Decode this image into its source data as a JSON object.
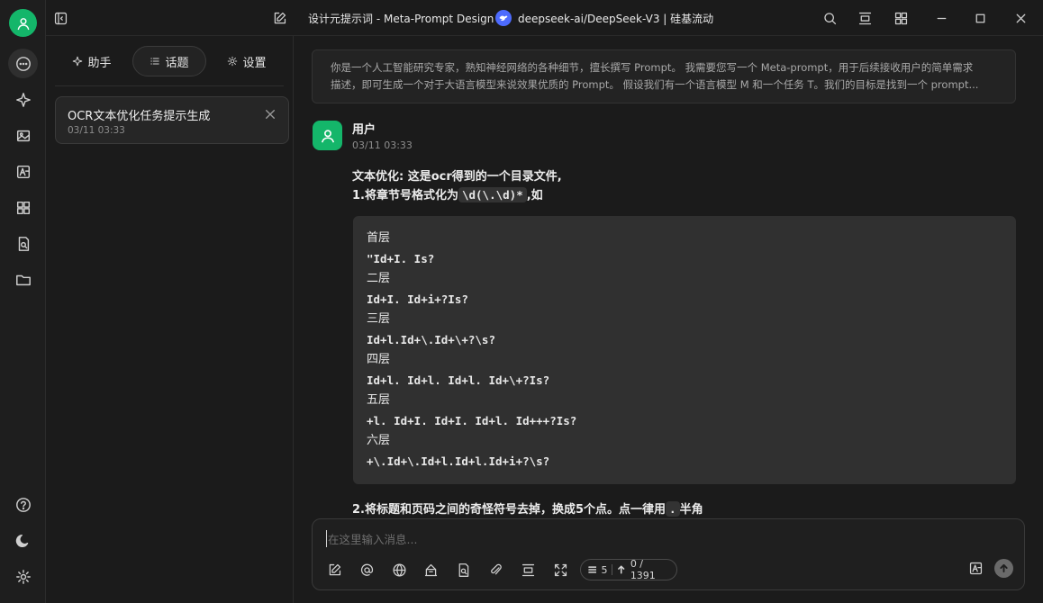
{
  "window": {
    "title": "设计元提示词 - Meta-Prompt Design",
    "model_label": "deepseek-ai/DeepSeek-V3 | 硅基流动"
  },
  "rail": {
    "items": [
      "chat-icon",
      "sparkle-icon",
      "image-icon",
      "translate-icon",
      "apps-icon",
      "file-search-icon",
      "folder-icon"
    ],
    "bottom": [
      "help-icon",
      "moon-icon",
      "gear-icon"
    ]
  },
  "panel": {
    "tabs": [
      {
        "label": "助手",
        "icon": "sparkle-icon"
      },
      {
        "label": "话题",
        "icon": "list-icon",
        "active": true
      },
      {
        "label": "设置",
        "icon": "gear-icon"
      }
    ],
    "topics": [
      {
        "name": "OCR文本优化任务提示生成",
        "date": "03/11 03:33"
      }
    ]
  },
  "chat": {
    "system_prompt": [
      "你是一个人工智能研究专家，熟知神经网络的各种细节，擅长撰写 Prompt。 我需要您写一个 Meta-prompt，用于后续接收用户的简单需求",
      "描述，即可生成一个对于大语言模型来说效果优质的 Prompt。 假设我们有一个语言模型 M 和一个任务 T。我们的目标是找到一个 prompt..."
    ],
    "message": {
      "user": "用户",
      "date": "03/11 03:33",
      "line1": "文本优化: 这是ocr得到的一个目录文件,",
      "line2_prefix": "1.将章节号格式化为",
      "line2_code": "\\d(\\.\\d)*",
      "line2_suffix": ",如",
      "code_lines": [
        {
          "text": "首层",
          "mono": false
        },
        {
          "text": "\"Id+I. Is?",
          "mono": true
        },
        {
          "text": "二层",
          "mono": false
        },
        {
          "text": "Id+I. Id+i+?Is?",
          "mono": true
        },
        {
          "text": "三层",
          "mono": false
        },
        {
          "text": "Id+l.Id+\\.Id+\\+?\\s?",
          "mono": true
        },
        {
          "text": "四层",
          "mono": false
        },
        {
          "text": "Id+l. Id+l. Id+l. Id+\\+?Is?",
          "mono": true
        },
        {
          "text": "五层",
          "mono": false
        },
        {
          "text": "+l. Id+I. Id+I. Id+l. Id+++?Is?",
          "mono": true
        },
        {
          "text": "六层",
          "mono": false
        },
        {
          "text": "+\\.Id+\\.Id+l.Id+l.Id+i+?\\s?",
          "mono": true
        }
      ],
      "line3_prefix": "2.将标题和页码之间的奇怪符号去掉，换成5个点。点一律用",
      "line3_code": ".",
      "line3_suffix": "半角"
    }
  },
  "input": {
    "placeholder": "在这里输入消息...",
    "context_count": "5",
    "token_count": "0 / 1391"
  },
  "colors": {
    "accent": "#14b66a",
    "background": "#1b1b1b",
    "code_bg": "#303030"
  }
}
